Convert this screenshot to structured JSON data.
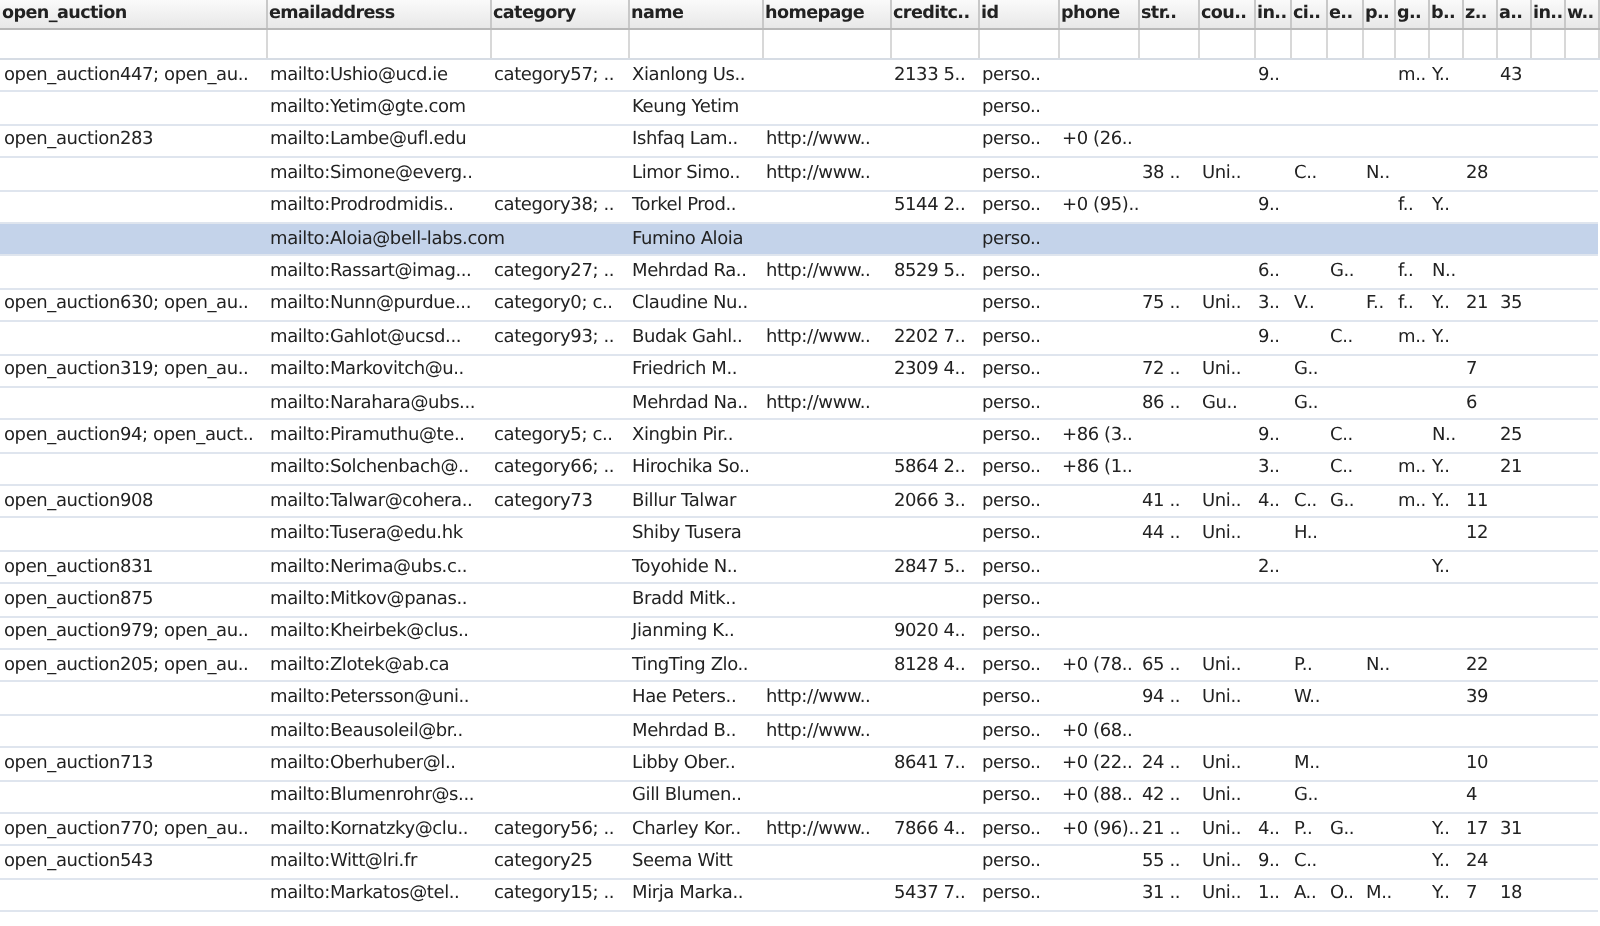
{
  "table": {
    "columns": [
      "open_auction",
      "emailaddress",
      "category",
      "name",
      "homepage",
      "creditc..",
      "id",
      "phone",
      "str..",
      "cou..",
      "in..",
      "ci..",
      "e..",
      "p..",
      "g..",
      "b..",
      "z..",
      "a..",
      "in..",
      "w.."
    ],
    "rows": [
      {
        "selected": false,
        "cells": [
          "open_auction447; open_au..",
          "mailto:Ushio@ucd.ie",
          "category57; ..",
          "Xianlong Us..",
          null,
          "2133 5..",
          "perso..",
          null,
          null,
          null,
          "9..",
          null,
          null,
          null,
          "m..",
          "Y..",
          null,
          "43",
          null,
          null
        ]
      },
      {
        "selected": false,
        "cells": [
          null,
          "mailto:Yetim@gte.com",
          null,
          "Keung Yetim",
          null,
          null,
          "perso..",
          null,
          null,
          null,
          null,
          null,
          null,
          null,
          null,
          null,
          null,
          null,
          null,
          null
        ]
      },
      {
        "selected": false,
        "cells": [
          "open_auction283",
          "mailto:Lambe@ufl.edu",
          null,
          "Ishfaq Lam..",
          "http://www..",
          null,
          "perso..",
          "+0 (26..",
          null,
          null,
          null,
          null,
          null,
          null,
          null,
          null,
          null,
          null,
          null,
          null
        ]
      },
      {
        "selected": false,
        "cells": [
          null,
          "mailto:Simone@everg..",
          null,
          "Limor Simo..",
          "http://www..",
          null,
          "perso..",
          null,
          "38 ..",
          "Uni..",
          null,
          "C..",
          null,
          "N..",
          null,
          null,
          "28",
          null,
          null,
          null
        ]
      },
      {
        "selected": false,
        "cells": [
          null,
          "mailto:Prodrodmidis..",
          "category38; ..",
          "Torkel Prod..",
          null,
          "5144 2..",
          "perso..",
          "+0 (95)..",
          null,
          null,
          "9..",
          null,
          null,
          null,
          "f..",
          "Y..",
          null,
          null,
          null,
          null
        ]
      },
      {
        "selected": true,
        "cells": [
          null,
          "mailto:Aloia@bell-labs.com",
          null,
          "Fumino Aloia",
          null,
          null,
          "perso..",
          null,
          null,
          null,
          null,
          null,
          null,
          null,
          null,
          null,
          null,
          null,
          null,
          null
        ]
      },
      {
        "selected": false,
        "cells": [
          null,
          "mailto:Rassart@imag...",
          "category27; ..",
          "Mehrdad Ra..",
          "http://www..",
          "8529 5..",
          "perso..",
          null,
          null,
          null,
          "6..",
          null,
          "G..",
          null,
          "f..",
          "N..",
          null,
          null,
          null,
          null
        ]
      },
      {
        "selected": false,
        "cells": [
          "open_auction630; open_au..",
          "mailto:Nunn@purdue...",
          "category0; c..",
          "Claudine Nu..",
          null,
          null,
          "perso..",
          null,
          "75 ..",
          "Uni..",
          "3..",
          "V..",
          null,
          "F..",
          "f..",
          "Y..",
          "21",
          "35",
          null,
          null
        ]
      },
      {
        "selected": false,
        "cells": [
          null,
          "mailto:Gahlot@ucsd...",
          "category93; ..",
          "Budak Gahl..",
          "http://www..",
          "2202 7..",
          "perso..",
          null,
          null,
          null,
          "9..",
          null,
          "C..",
          null,
          "m..",
          "Y..",
          null,
          null,
          null,
          null
        ]
      },
      {
        "selected": false,
        "cells": [
          "open_auction319; open_au..",
          "mailto:Markovitch@u..",
          null,
          "Friedrich M..",
          null,
          "2309 4..",
          "perso..",
          null,
          "72 ..",
          "Uni..",
          null,
          "G..",
          null,
          null,
          null,
          null,
          "7",
          null,
          null,
          null
        ]
      },
      {
        "selected": false,
        "cells": [
          null,
          "mailto:Narahara@ubs...",
          null,
          "Mehrdad Na..",
          "http://www..",
          null,
          "perso..",
          null,
          "86 ..",
          "Gu..",
          null,
          "G..",
          null,
          null,
          null,
          null,
          "6",
          null,
          null,
          null
        ]
      },
      {
        "selected": false,
        "cells": [
          "open_auction94; open_auct..",
          "mailto:Piramuthu@te..",
          "category5; c..",
          "Xingbin Pir..",
          null,
          null,
          "perso..",
          "+86 (3..",
          null,
          null,
          "9..",
          null,
          "C..",
          null,
          null,
          "N..",
          null,
          "25",
          null,
          null
        ]
      },
      {
        "selected": false,
        "cells": [
          null,
          "mailto:Solchenbach@..",
          "category66; ..",
          "Hirochika So..",
          null,
          "5864 2..",
          "perso..",
          "+86 (1..",
          null,
          null,
          "3..",
          null,
          "C..",
          null,
          "m..",
          "Y..",
          null,
          "21",
          null,
          null
        ]
      },
      {
        "selected": false,
        "cells": [
          "open_auction908",
          "mailto:Talwar@cohera..",
          "category73",
          "Billur Talwar",
          null,
          "2066 3..",
          "perso..",
          null,
          "41 ..",
          "Uni..",
          "4..",
          "C..",
          "G..",
          null,
          "m..",
          "Y..",
          "11",
          null,
          null,
          null
        ]
      },
      {
        "selected": false,
        "cells": [
          null,
          "mailto:Tusera@edu.hk",
          null,
          "Shiby Tusera",
          null,
          null,
          "perso..",
          null,
          "44 ..",
          "Uni..",
          null,
          "H..",
          null,
          null,
          null,
          null,
          "12",
          null,
          null,
          null
        ]
      },
      {
        "selected": false,
        "cells": [
          "open_auction831",
          "mailto:Nerima@ubs.c..",
          null,
          "Toyohide N..",
          null,
          "2847 5..",
          "perso..",
          null,
          null,
          null,
          "2..",
          null,
          null,
          null,
          null,
          "Y..",
          null,
          null,
          null,
          null
        ]
      },
      {
        "selected": false,
        "cells": [
          "open_auction875",
          "mailto:Mitkov@panas..",
          null,
          "Bradd Mitk..",
          null,
          null,
          "perso..",
          null,
          null,
          null,
          null,
          null,
          null,
          null,
          null,
          null,
          null,
          null,
          null,
          null
        ]
      },
      {
        "selected": false,
        "cells": [
          "open_auction979; open_au..",
          "mailto:Kheirbek@clus..",
          null,
          "Jianming K..",
          null,
          "9020 4..",
          "perso..",
          null,
          null,
          null,
          null,
          null,
          null,
          null,
          null,
          null,
          null,
          null,
          null,
          null
        ]
      },
      {
        "selected": false,
        "cells": [
          "open_auction205; open_au..",
          "mailto:Zlotek@ab.ca",
          null,
          "TingTing Zlo..",
          null,
          "8128 4..",
          "perso..",
          "+0 (78..",
          "65 ..",
          "Uni..",
          null,
          "P..",
          null,
          "N..",
          null,
          null,
          "22",
          null,
          null,
          null
        ]
      },
      {
        "selected": false,
        "cells": [
          null,
          "mailto:Petersson@uni..",
          null,
          "Hae Peters..",
          "http://www..",
          null,
          "perso..",
          null,
          "94 ..",
          "Uni..",
          null,
          "W..",
          null,
          null,
          null,
          null,
          "39",
          null,
          null,
          null
        ]
      },
      {
        "selected": false,
        "cells": [
          null,
          "mailto:Beausoleil@br..",
          null,
          "Mehrdad B..",
          "http://www..",
          null,
          "perso..",
          "+0 (68..",
          null,
          null,
          null,
          null,
          null,
          null,
          null,
          null,
          null,
          null,
          null,
          null
        ]
      },
      {
        "selected": false,
        "cells": [
          "open_auction713",
          "mailto:Oberhuber@l..",
          null,
          "Libby Ober..",
          null,
          "8641 7..",
          "perso..",
          "+0 (22..",
          "24 ..",
          "Uni..",
          null,
          "M..",
          null,
          null,
          null,
          null,
          "10",
          null,
          null,
          null
        ]
      },
      {
        "selected": false,
        "cells": [
          null,
          "mailto:Blumenrohr@s...",
          null,
          "Gill Blumen..",
          null,
          null,
          "perso..",
          "+0 (88..",
          "42 ..",
          "Uni..",
          null,
          "G..",
          null,
          null,
          null,
          null,
          "4",
          null,
          null,
          null
        ]
      },
      {
        "selected": false,
        "cells": [
          "open_auction770; open_au..",
          "mailto:Kornatzky@clu..",
          "category56; ..",
          "Charley Kor..",
          "http://www..",
          "7866 4..",
          "perso..",
          "+0 (96)..",
          "21 ..",
          "Uni..",
          "4..",
          "P..",
          "G..",
          null,
          null,
          "Y..",
          "17",
          "31",
          null,
          null
        ]
      },
      {
        "selected": false,
        "cells": [
          "open_auction543",
          "mailto:Witt@lri.fr",
          "category25",
          "Seema Witt",
          null,
          null,
          "perso..",
          null,
          "55 ..",
          "Uni..",
          "9..",
          "C..",
          null,
          null,
          null,
          "Y..",
          "24",
          null,
          null,
          null
        ]
      },
      {
        "selected": false,
        "cells": [
          null,
          "mailto:Markatos@tel..",
          "category15; ..",
          "Mirja Marka..",
          null,
          "5437 7..",
          "perso..",
          null,
          "31 ..",
          "Uni..",
          "1..",
          "A..",
          "O..",
          "M..",
          null,
          "Y..",
          "7",
          "18",
          null,
          null
        ]
      }
    ]
  }
}
